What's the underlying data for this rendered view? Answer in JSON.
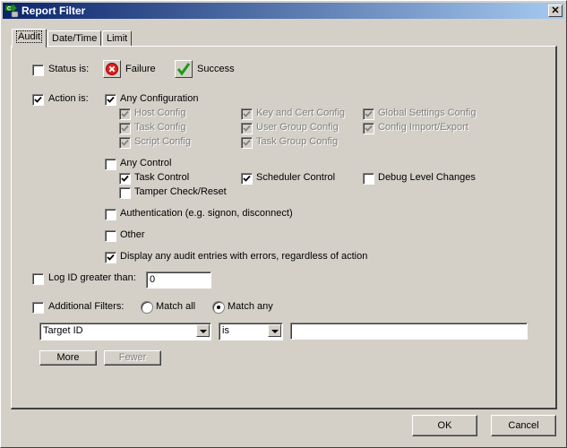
{
  "window": {
    "title": "Report Filter",
    "close_label": "✕"
  },
  "tabs": [
    {
      "label": "Audit",
      "active": true
    },
    {
      "label": "Date/Time",
      "active": false
    },
    {
      "label": "Limit",
      "active": false
    }
  ],
  "status": {
    "label": "Status is:",
    "checked": false,
    "failure_label": "Failure",
    "success_label": "Success"
  },
  "action": {
    "label": "Action is:",
    "checked": true,
    "any_configuration": {
      "label": "Any Configuration",
      "checked": true
    },
    "config_items": [
      {
        "label": "Host Config",
        "checked": true,
        "disabled": true
      },
      {
        "label": "Task Config",
        "checked": true,
        "disabled": true
      },
      {
        "label": "Script Config",
        "checked": true,
        "disabled": true
      },
      {
        "label": "Key and Cert Config",
        "checked": true,
        "disabled": true
      },
      {
        "label": "User Group Config",
        "checked": true,
        "disabled": true
      },
      {
        "label": "Task Group Config",
        "checked": true,
        "disabled": true
      },
      {
        "label": "Global Settings Config",
        "checked": true,
        "disabled": true
      },
      {
        "label": "Config Import/Export",
        "checked": true,
        "disabled": true
      }
    ],
    "any_control": {
      "label": "Any Control",
      "checked": false
    },
    "control_items": [
      {
        "label": "Task Control",
        "checked": true
      },
      {
        "label": "Scheduler Control",
        "checked": true
      },
      {
        "label": "Debug Level Changes",
        "checked": false
      },
      {
        "label": "Tamper Check/Reset",
        "checked": false
      }
    ],
    "authentication": {
      "label": "Authentication (e.g. signon, disconnect)",
      "checked": false
    },
    "other": {
      "label": "Other",
      "checked": false
    },
    "display_errors": {
      "label": "Display any audit entries with errors, regardless of action",
      "checked": true
    }
  },
  "log_id": {
    "label": "Log ID greater than:",
    "checked": false,
    "value": "0"
  },
  "additional_filters": {
    "label": "Additional Filters:",
    "checked": false,
    "match_all_label": "Match all",
    "match_any_label": "Match any",
    "selected_match": "any",
    "field_select": "Target ID",
    "operator_select": "is",
    "value": "",
    "more_label": "More",
    "fewer_label": "Fewer"
  },
  "footer": {
    "ok_label": "OK",
    "cancel_label": "Cancel"
  }
}
